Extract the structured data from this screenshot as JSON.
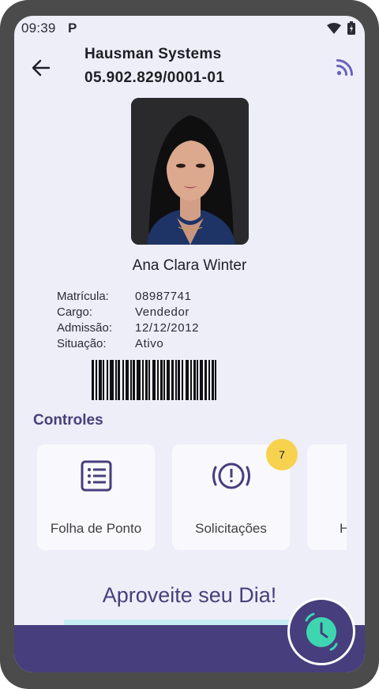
{
  "status_bar": {
    "time": "09:39",
    "notification": "P"
  },
  "header": {
    "company_name": "Hausman Systems",
    "company_cnpj": "05.902.829/0001-01"
  },
  "employee": {
    "name": "Ana Clara Winter",
    "fields": [
      {
        "label": "Matrícula:",
        "value": "08987741"
      },
      {
        "label": "Cargo:",
        "value": "Vendedor"
      },
      {
        "label": "Admissão:",
        "value": "12/12/2012"
      },
      {
        "label": "Situação:",
        "value": "Ativo"
      }
    ]
  },
  "controls": {
    "title": "Controles",
    "cards": [
      {
        "label": "Folha de Ponto",
        "icon": "list-icon"
      },
      {
        "label": "Solicitações",
        "icon": "alert-circle-icon",
        "badge": "7"
      },
      {
        "label": "H",
        "icon": "unknown"
      }
    ]
  },
  "greeting": "Aproveite seu Dia!",
  "colors": {
    "primary": "#473e7d",
    "accent": "#3ed6b0",
    "badge": "#f7d24e",
    "background": "#eeeef9"
  }
}
